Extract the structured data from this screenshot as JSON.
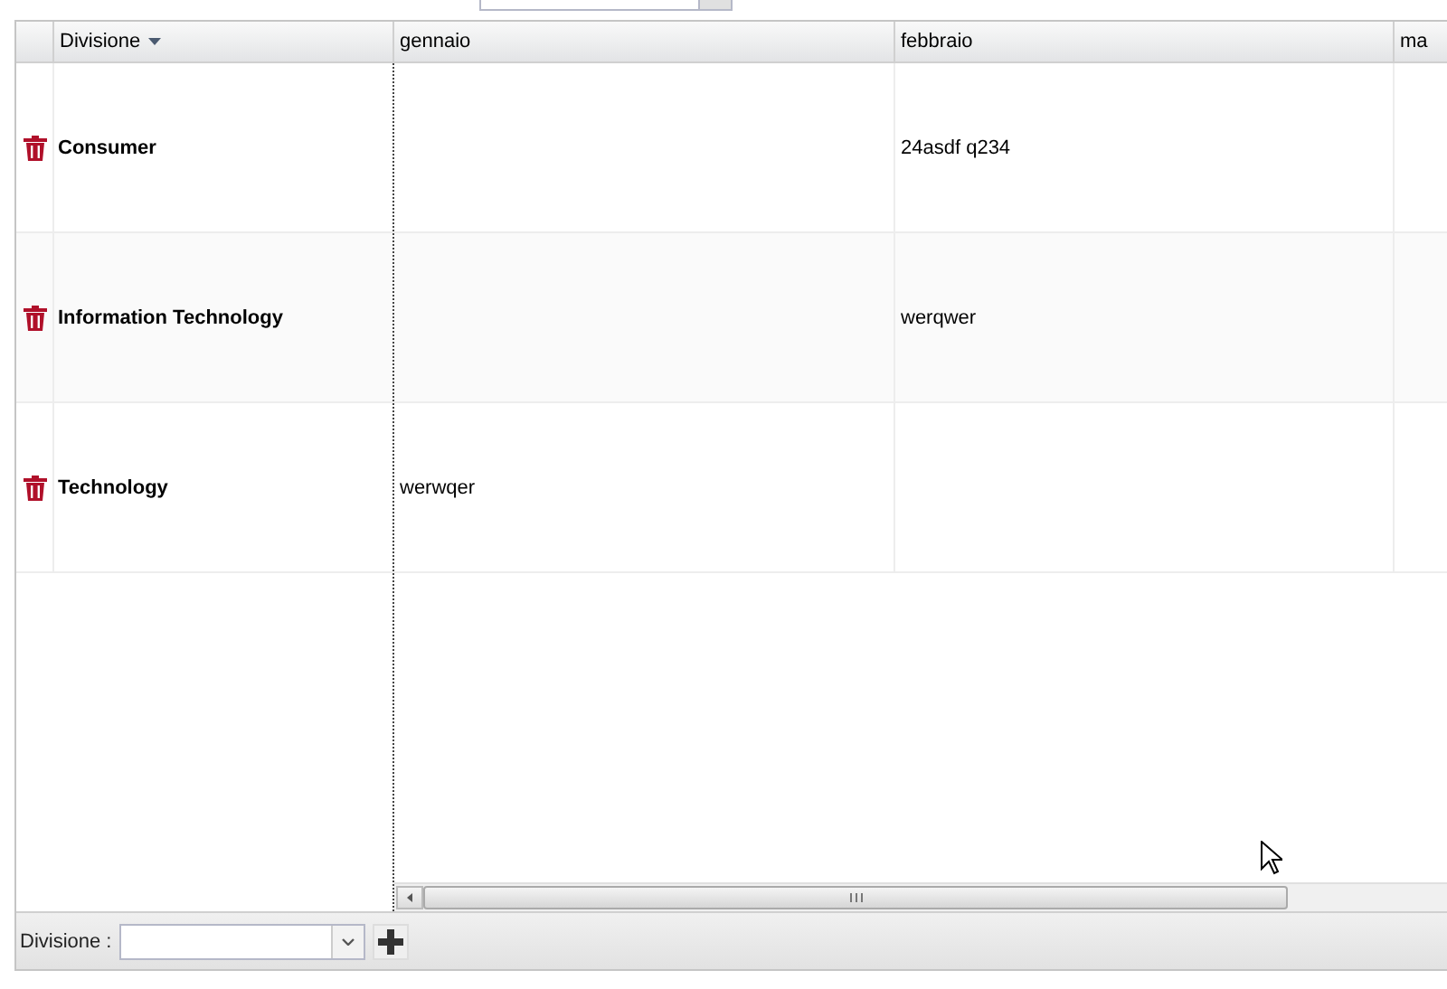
{
  "top_field": {
    "kind": "combo"
  },
  "grid": {
    "columns": [
      {
        "label": "Divisione",
        "sorted": true
      },
      {
        "label": "gennaio",
        "sorted": false
      },
      {
        "label": "febbraio",
        "sorted": false
      },
      {
        "label": "ma",
        "sorted": false
      }
    ],
    "rows": [
      {
        "cells": [
          "Consumer",
          "",
          "24asdf q234",
          ""
        ]
      },
      {
        "cells": [
          "Information Technology",
          "",
          "werqwer",
          ""
        ]
      },
      {
        "cells": [
          "Technology",
          "werwqer",
          "",
          ""
        ]
      }
    ]
  },
  "footer": {
    "label": "Divisione :"
  }
}
